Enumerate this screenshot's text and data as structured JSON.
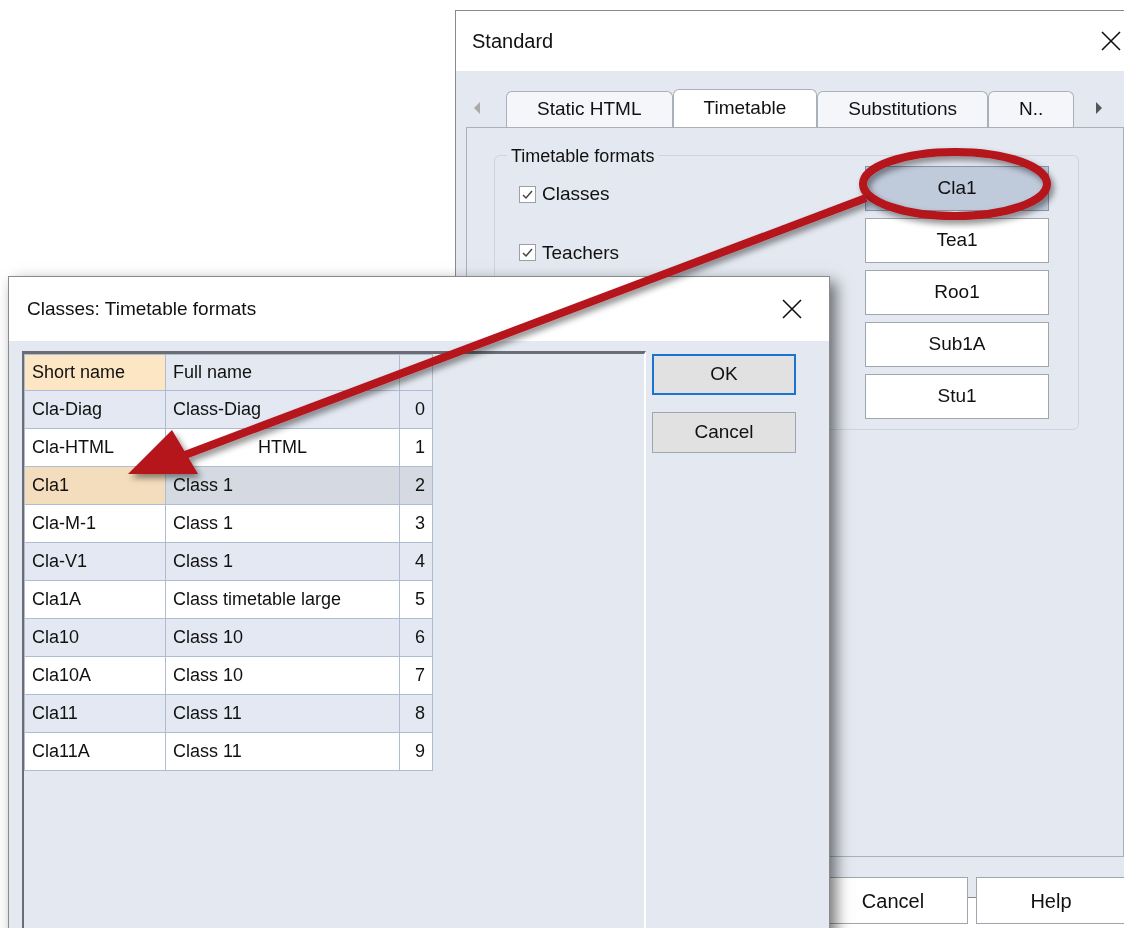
{
  "back_dialog": {
    "title": "Standard",
    "tabs": [
      {
        "label": "Static HTML",
        "selected": false
      },
      {
        "label": "Timetable",
        "selected": true
      },
      {
        "label": "Substitutions",
        "selected": false
      },
      {
        "label": "N..",
        "selected": false
      }
    ],
    "group": {
      "title": "Timetable formats",
      "checkboxes": [
        {
          "label": "Classes",
          "checked": true
        },
        {
          "label": "Teachers",
          "checked": true
        }
      ],
      "format_buttons": [
        {
          "label": "Cla1",
          "selected": true
        },
        {
          "label": "Tea1",
          "selected": false
        },
        {
          "label": "Roo1",
          "selected": false
        },
        {
          "label": "Sub1A",
          "selected": false
        },
        {
          "label": "Stu1",
          "selected": false
        }
      ]
    },
    "buttons": [
      "Cancel",
      "Help"
    ]
  },
  "front_dialog": {
    "title": "Classes: Timetable formats",
    "table": {
      "columns": [
        {
          "label": "Short name",
          "highlighted": true
        },
        {
          "label": "Full name",
          "highlighted": false
        }
      ],
      "rows": [
        {
          "kind": "plain",
          "short_name": "Cla-Diag",
          "full_name": "Class-Diag",
          "index": "0",
          "selected": false
        },
        {
          "kind": "covered",
          "short_name": "Cla-HTML",
          "full_name": "HTML",
          "index": "1",
          "selected": false
        },
        {
          "kind": "plain",
          "short_name": "Cla1",
          "full_name": "Class 1",
          "index": "2",
          "selected": true
        },
        {
          "kind": "plain",
          "short_name": "Cla-M-1",
          "full_name": "Class 1",
          "index": "3",
          "selected": false
        },
        {
          "kind": "plain",
          "short_name": "Cla-V1",
          "full_name": "Class 1",
          "index": "4",
          "selected": false
        },
        {
          "kind": "plain",
          "short_name": "Cla1A",
          "full_name": "Class timetable large",
          "index": "5",
          "selected": false
        },
        {
          "kind": "plain",
          "short_name": "Cla10",
          "full_name": "Class 10",
          "index": "6",
          "selected": false
        },
        {
          "kind": "plain",
          "short_name": "Cla10A",
          "full_name": "Class 10",
          "index": "7",
          "selected": false
        },
        {
          "kind": "plain",
          "short_name": "Cla11",
          "full_name": "Class 11",
          "index": "8",
          "selected": false
        },
        {
          "kind": "plain",
          "short_name": "Cla11A",
          "full_name": "Class 11",
          "index": "9",
          "selected": false
        }
      ]
    },
    "buttons": [
      {
        "label": "OK",
        "default": true
      },
      {
        "label": "Cancel",
        "default": false
      }
    ]
  }
}
